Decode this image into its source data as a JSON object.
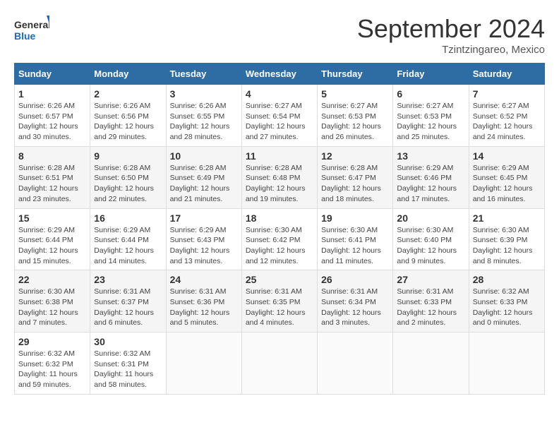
{
  "logo": {
    "line1": "General",
    "line2": "Blue"
  },
  "title": "September 2024",
  "subtitle": "Tzintzingareo, Mexico",
  "days_header": [
    "Sunday",
    "Monday",
    "Tuesday",
    "Wednesday",
    "Thursday",
    "Friday",
    "Saturday"
  ],
  "weeks": [
    [
      {
        "num": "1",
        "info": "Sunrise: 6:26 AM\nSunset: 6:57 PM\nDaylight: 12 hours\nand 30 minutes."
      },
      {
        "num": "2",
        "info": "Sunrise: 6:26 AM\nSunset: 6:56 PM\nDaylight: 12 hours\nand 29 minutes."
      },
      {
        "num": "3",
        "info": "Sunrise: 6:26 AM\nSunset: 6:55 PM\nDaylight: 12 hours\nand 28 minutes."
      },
      {
        "num": "4",
        "info": "Sunrise: 6:27 AM\nSunset: 6:54 PM\nDaylight: 12 hours\nand 27 minutes."
      },
      {
        "num": "5",
        "info": "Sunrise: 6:27 AM\nSunset: 6:53 PM\nDaylight: 12 hours\nand 26 minutes."
      },
      {
        "num": "6",
        "info": "Sunrise: 6:27 AM\nSunset: 6:53 PM\nDaylight: 12 hours\nand 25 minutes."
      },
      {
        "num": "7",
        "info": "Sunrise: 6:27 AM\nSunset: 6:52 PM\nDaylight: 12 hours\nand 24 minutes."
      }
    ],
    [
      {
        "num": "8",
        "info": "Sunrise: 6:28 AM\nSunset: 6:51 PM\nDaylight: 12 hours\nand 23 minutes."
      },
      {
        "num": "9",
        "info": "Sunrise: 6:28 AM\nSunset: 6:50 PM\nDaylight: 12 hours\nand 22 minutes."
      },
      {
        "num": "10",
        "info": "Sunrise: 6:28 AM\nSunset: 6:49 PM\nDaylight: 12 hours\nand 21 minutes."
      },
      {
        "num": "11",
        "info": "Sunrise: 6:28 AM\nSunset: 6:48 PM\nDaylight: 12 hours\nand 19 minutes."
      },
      {
        "num": "12",
        "info": "Sunrise: 6:28 AM\nSunset: 6:47 PM\nDaylight: 12 hours\nand 18 minutes."
      },
      {
        "num": "13",
        "info": "Sunrise: 6:29 AM\nSunset: 6:46 PM\nDaylight: 12 hours\nand 17 minutes."
      },
      {
        "num": "14",
        "info": "Sunrise: 6:29 AM\nSunset: 6:45 PM\nDaylight: 12 hours\nand 16 minutes."
      }
    ],
    [
      {
        "num": "15",
        "info": "Sunrise: 6:29 AM\nSunset: 6:44 PM\nDaylight: 12 hours\nand 15 minutes."
      },
      {
        "num": "16",
        "info": "Sunrise: 6:29 AM\nSunset: 6:44 PM\nDaylight: 12 hours\nand 14 minutes."
      },
      {
        "num": "17",
        "info": "Sunrise: 6:29 AM\nSunset: 6:43 PM\nDaylight: 12 hours\nand 13 minutes."
      },
      {
        "num": "18",
        "info": "Sunrise: 6:30 AM\nSunset: 6:42 PM\nDaylight: 12 hours\nand 12 minutes."
      },
      {
        "num": "19",
        "info": "Sunrise: 6:30 AM\nSunset: 6:41 PM\nDaylight: 12 hours\nand 11 minutes."
      },
      {
        "num": "20",
        "info": "Sunrise: 6:30 AM\nSunset: 6:40 PM\nDaylight: 12 hours\nand 9 minutes."
      },
      {
        "num": "21",
        "info": "Sunrise: 6:30 AM\nSunset: 6:39 PM\nDaylight: 12 hours\nand 8 minutes."
      }
    ],
    [
      {
        "num": "22",
        "info": "Sunrise: 6:30 AM\nSunset: 6:38 PM\nDaylight: 12 hours\nand 7 minutes."
      },
      {
        "num": "23",
        "info": "Sunrise: 6:31 AM\nSunset: 6:37 PM\nDaylight: 12 hours\nand 6 minutes."
      },
      {
        "num": "24",
        "info": "Sunrise: 6:31 AM\nSunset: 6:36 PM\nDaylight: 12 hours\nand 5 minutes."
      },
      {
        "num": "25",
        "info": "Sunrise: 6:31 AM\nSunset: 6:35 PM\nDaylight: 12 hours\nand 4 minutes."
      },
      {
        "num": "26",
        "info": "Sunrise: 6:31 AM\nSunset: 6:34 PM\nDaylight: 12 hours\nand 3 minutes."
      },
      {
        "num": "27",
        "info": "Sunrise: 6:31 AM\nSunset: 6:33 PM\nDaylight: 12 hours\nand 2 minutes."
      },
      {
        "num": "28",
        "info": "Sunrise: 6:32 AM\nSunset: 6:33 PM\nDaylight: 12 hours\nand 0 minutes."
      }
    ],
    [
      {
        "num": "29",
        "info": "Sunrise: 6:32 AM\nSunset: 6:32 PM\nDaylight: 11 hours\nand 59 minutes."
      },
      {
        "num": "30",
        "info": "Sunrise: 6:32 AM\nSunset: 6:31 PM\nDaylight: 11 hours\nand 58 minutes."
      },
      {
        "num": "",
        "info": ""
      },
      {
        "num": "",
        "info": ""
      },
      {
        "num": "",
        "info": ""
      },
      {
        "num": "",
        "info": ""
      },
      {
        "num": "",
        "info": ""
      }
    ]
  ]
}
